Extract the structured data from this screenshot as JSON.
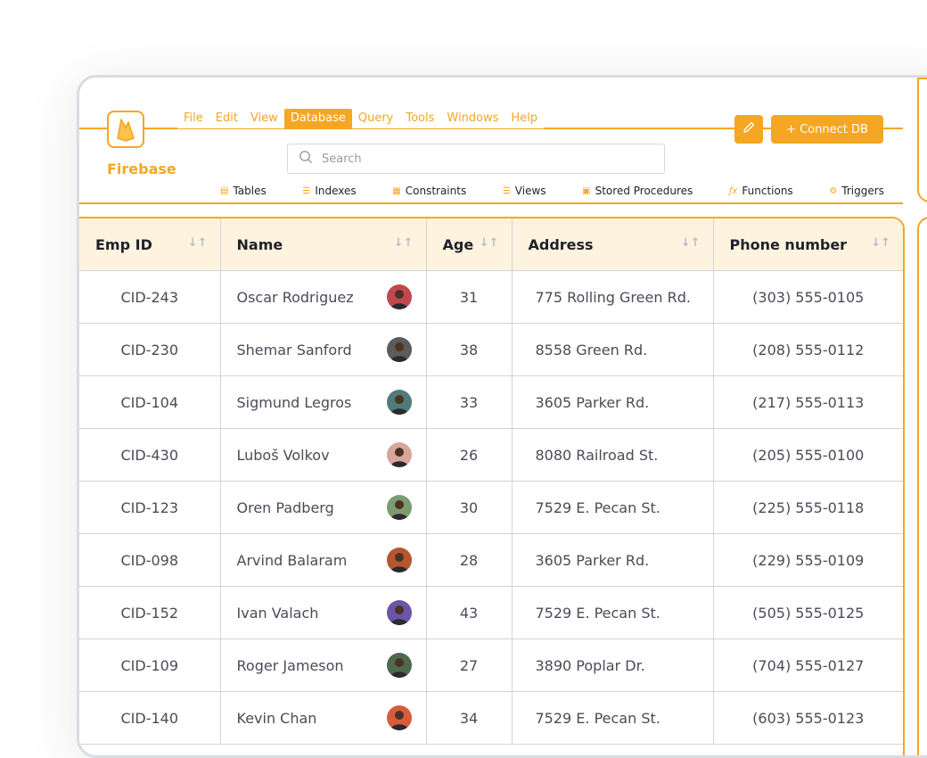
{
  "app": {
    "brand": "Firebase",
    "accent": "#f5a623"
  },
  "menu": [
    "File",
    "Edit",
    "View",
    "Database",
    "Query",
    "Tools",
    "Windows",
    "Help"
  ],
  "menu_active": "Database",
  "search": {
    "placeholder": "Search"
  },
  "buttons": {
    "connect": "+ Connect DB",
    "edit_icon": "pencil-icon"
  },
  "toolbar": [
    {
      "label": "Tables",
      "icon": "table-icon"
    },
    {
      "label": "Indexes",
      "icon": "list-icon"
    },
    {
      "label": "Constraints",
      "icon": "constraint-icon"
    },
    {
      "label": "Views",
      "icon": "view-icon"
    },
    {
      "label": "Stored Procedures",
      "icon": "procedure-icon"
    },
    {
      "label": "Functions",
      "icon": "function-icon"
    },
    {
      "label": "Triggers",
      "icon": "trigger-icon"
    }
  ],
  "table": {
    "columns": [
      "Emp ID",
      "Name",
      "Age",
      "Address",
      "Phone number"
    ],
    "rows": [
      {
        "id": "CID-243",
        "name": "Oscar Rodriguez",
        "age": "31",
        "address": "775 Rolling Green Rd.",
        "phone": "(303) 555-0105",
        "avatar_color": "#c2484f"
      },
      {
        "id": "CID-230",
        "name": "Shemar Sanford",
        "age": "38",
        "address": "8558 Green Rd.",
        "phone": "(208) 555-0112",
        "avatar_color": "#5b5b5b"
      },
      {
        "id": "CID-104",
        "name": "Sigmund Legros",
        "age": "33",
        "address": "3605 Parker Rd.",
        "phone": "(217) 555-0113",
        "avatar_color": "#4f7b7a"
      },
      {
        "id": "CID-430",
        "name": "Luboš Volkov",
        "age": "26",
        "address": "8080 Railroad St.",
        "phone": "(205) 555-0100",
        "avatar_color": "#d7a79b"
      },
      {
        "id": "CID-123",
        "name": "Oren Padberg",
        "age": "30",
        "address": "7529 E. Pecan St.",
        "phone": "(225) 555-0118",
        "avatar_color": "#7a9c70"
      },
      {
        "id": "CID-098",
        "name": "Arvind Balaram",
        "age": "28",
        "address": "3605 Parker Rd.",
        "phone": "(229) 555-0109",
        "avatar_color": "#b6562f"
      },
      {
        "id": "CID-152",
        "name": "Ivan Valach",
        "age": "43",
        "address": "7529 E. Pecan St.",
        "phone": "(505) 555-0125",
        "avatar_color": "#6a55a8"
      },
      {
        "id": "CID-109",
        "name": "Roger Jameson",
        "age": "27",
        "address": "3890 Poplar Dr.",
        "phone": "(704) 555-0127",
        "avatar_color": "#4d6a4f"
      },
      {
        "id": "CID-140",
        "name": "Kevin Chan",
        "age": "34",
        "address": "7529 E. Pecan St.",
        "phone": "(603) 555-0123",
        "avatar_color": "#d85c3c"
      }
    ]
  }
}
